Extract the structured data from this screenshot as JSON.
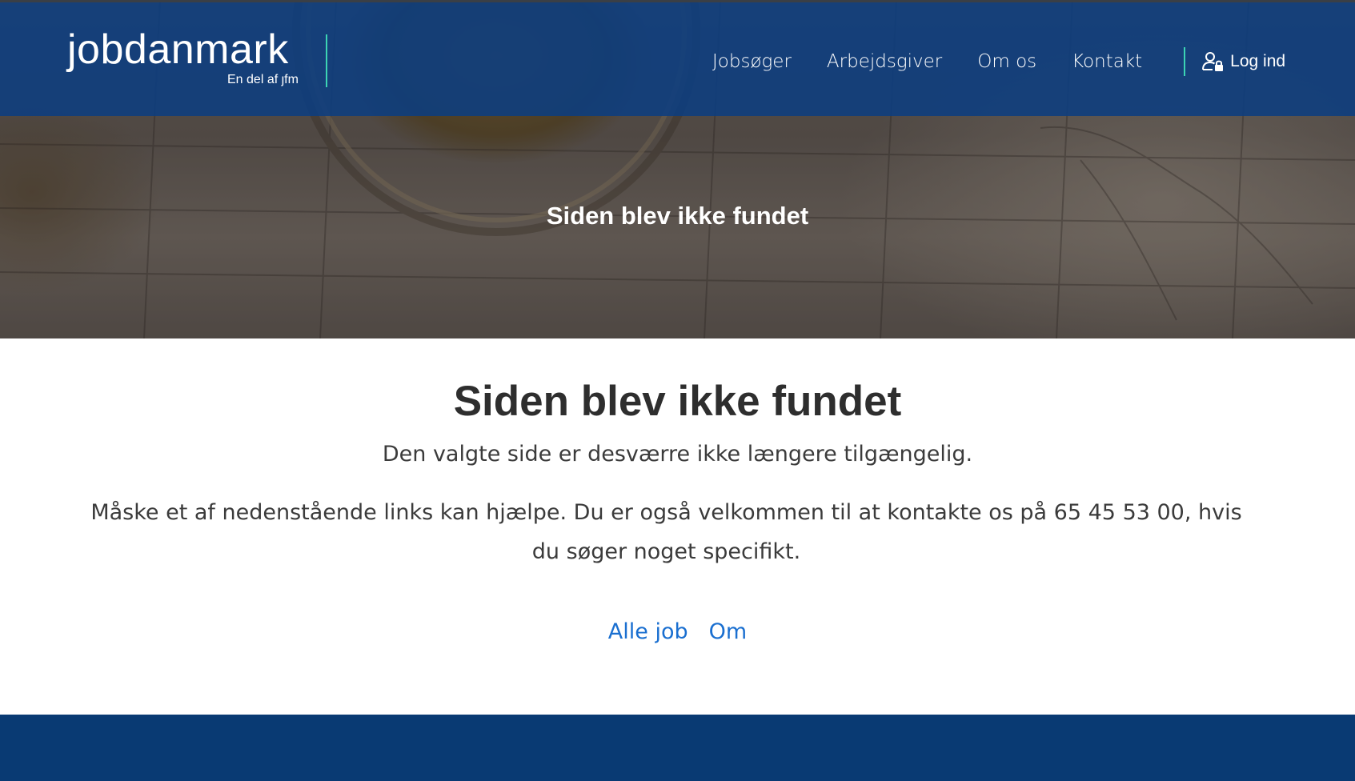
{
  "header": {
    "logo": {
      "wordmark": "jobdanmark",
      "tagline": "En del af ȷfm"
    },
    "nav": [
      {
        "label": "Jobsøger"
      },
      {
        "label": "Arbejdsgiver"
      },
      {
        "label": "Om os"
      },
      {
        "label": "Kontakt"
      }
    ],
    "login_label": "Log ind",
    "login_icon": "user-lock-icon"
  },
  "hero": {
    "title": "Siden blev ikke fundet"
  },
  "main": {
    "title": "Siden blev ikke fundet",
    "lead": "Den valgte side er desværre ikke længere tilgængelig.",
    "text": "Måske et af nedenstående links kan hjælpe. Du er også velkommen til at kontakte os på 65 45 53 00, hvis du søger noget specifikt.",
    "links": [
      {
        "label": "Alle job"
      },
      {
        "label": "Om"
      }
    ]
  },
  "colors": {
    "header_bg": "#0c3e80",
    "accent": "#3cd4b4",
    "link": "#1a6fd0",
    "footer_bg": "#093a73",
    "heading_text": "#2e2e2e"
  }
}
